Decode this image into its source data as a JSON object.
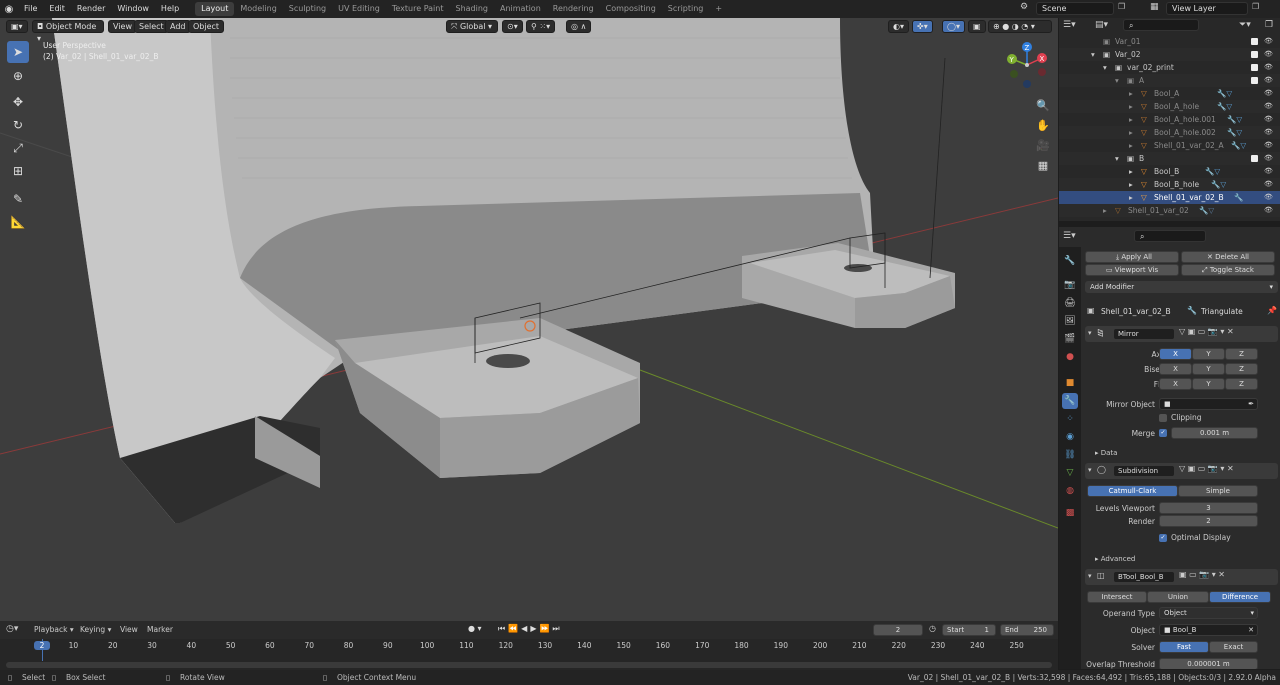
{
  "topbar": {
    "menus": [
      "File",
      "Edit",
      "Render",
      "Window",
      "Help"
    ],
    "workspaces": [
      "Layout",
      "Modeling",
      "Sculpting",
      "UV Editing",
      "Texture Paint",
      "Shading",
      "Animation",
      "Rendering",
      "Compositing",
      "Scripting"
    ],
    "active_workspace": "Layout",
    "scene": "Scene",
    "view_layer": "View Layer"
  },
  "viewport": {
    "mode": "Object Mode",
    "menus": [
      "View",
      "Select",
      "Add",
      "Object"
    ],
    "transform_orientation": "Global",
    "overlay_title": "User Perspective",
    "overlay_sub": "(2) Var_02 | Shell_01_var_02_B",
    "gizmo_axes": [
      "Z",
      "Y",
      "X"
    ]
  },
  "outliner": {
    "search_placeholder": "",
    "rows": [
      {
        "label": "Var_01",
        "muted": true
      },
      {
        "label": "Var_02"
      },
      {
        "label": "var_02_print"
      },
      {
        "label": "A",
        "muted": true
      },
      {
        "label": "Bool_A",
        "muted": true
      },
      {
        "label": "Bool_A_hole",
        "muted": true
      },
      {
        "label": "Bool_A_hole.001",
        "muted": true
      },
      {
        "label": "Bool_A_hole.002",
        "muted": true
      },
      {
        "label": "Shell_01_var_02_A",
        "muted": true
      },
      {
        "label": "B"
      },
      {
        "label": "Bool_B"
      },
      {
        "label": "Bool_B_hole"
      },
      {
        "label": "Shell_01_var_02_B"
      },
      {
        "label": "Shell_01_var_02",
        "muted": true
      }
    ]
  },
  "properties": {
    "apply_all": "Apply All",
    "delete_all": "Delete All",
    "viewport_vis": "Viewport Vis",
    "toggle_stack": "Toggle Stack",
    "add_modifier": "Add Modifier",
    "object_name": "Shell_01_var_02_B",
    "triangulate": "Triangulate",
    "mirror": {
      "name": "Mirror",
      "axis_label": "Axis",
      "bisect_label": "Bisect",
      "flip_label": "Flip",
      "x": "X",
      "y": "Y",
      "z": "Z",
      "mirror_object_label": "Mirror Object",
      "clipping": "Clipping",
      "merge_label": "Merge",
      "merge_value": "0.001 m",
      "data": "Data"
    },
    "subdivision": {
      "name": "Subdivision",
      "catmull": "Catmull-Clark",
      "simple": "Simple",
      "levels_label": "Levels Viewport",
      "levels_value": "3",
      "render_label": "Render",
      "render_value": "2",
      "optimal": "Optimal Display",
      "advanced": "Advanced"
    },
    "btool": {
      "name": "BTool_Bool_B",
      "intersect": "Intersect",
      "union": "Union",
      "difference": "Difference",
      "operand_label": "Operand Type",
      "operand_value": "Object",
      "object_label": "Object",
      "object_value": "Bool_B",
      "solver_label": "Solver",
      "fast": "Fast",
      "exact": "Exact",
      "overlap_label": "Overlap Threshold",
      "overlap_value": "0.000001 m"
    }
  },
  "timeline": {
    "menus": [
      "Playback",
      "Keying",
      "View",
      "Marker"
    ],
    "current_frame": "2",
    "start_label": "Start",
    "start": "1",
    "end_label": "End",
    "end": "250",
    "ticks": [
      "2",
      "10",
      "20",
      "30",
      "40",
      "50",
      "60",
      "70",
      "80",
      "90",
      "100",
      "110",
      "120",
      "130",
      "140",
      "150",
      "160",
      "170",
      "180",
      "190",
      "200",
      "210",
      "220",
      "230",
      "240",
      "250"
    ]
  },
  "status": {
    "select": "Select",
    "box_select": "Box Select",
    "rotate_view": "Rotate View",
    "context_menu": "Object Context Menu",
    "stats": "Var_02 | Shell_01_var_02_B | Verts:32,598 | Faces:64,492 | Tris:65,188 | Objects:0/3 | 2.92.0 Alpha"
  },
  "colors": {
    "accent": "#4772b3",
    "axis_x": "#e04050",
    "axis_y": "#80b030",
    "axis_z": "#3080e0"
  }
}
